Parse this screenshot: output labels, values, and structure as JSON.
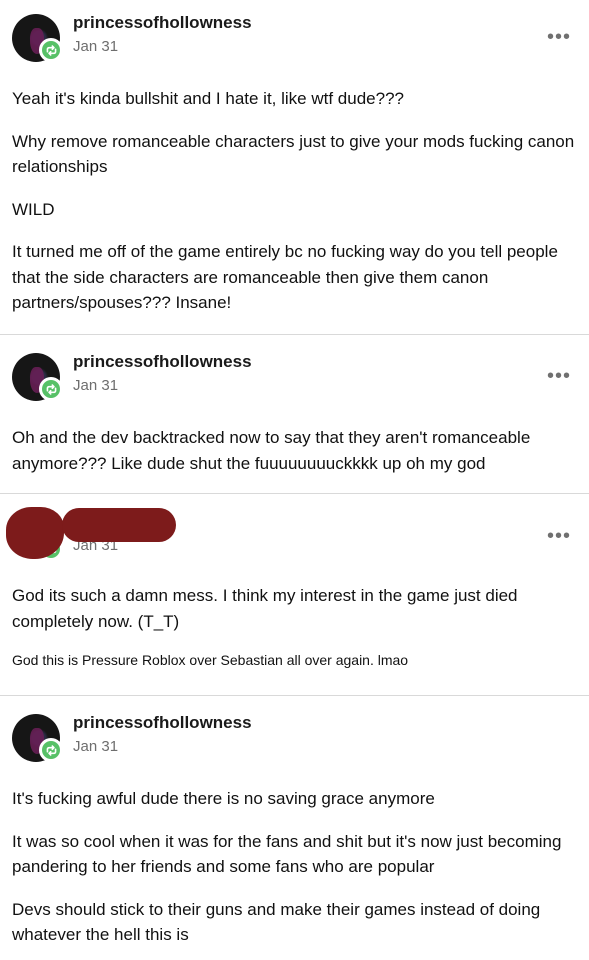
{
  "posts": [
    {
      "username": "princessofhollowness",
      "date": "Jan 31",
      "paragraphs": [
        "Yeah it's kinda bullshit and I hate it, like wtf dude???",
        "Why remove romanceable characters just to give your mods fucking canon relationships",
        "WILD",
        "It turned me off of the game entirely bc no fucking way do you tell people that the side characters are romanceable then give them canon partners/spouses??? Insane!"
      ]
    },
    {
      "username": "princessofhollowness",
      "date": "Jan 31",
      "paragraphs": [
        "Oh and the dev backtracked now to say that they aren't romanceable anymore??? Like dude shut the fuuuuuuuuckkkk up oh my god"
      ]
    },
    {
      "username": "",
      "date": "Jan 31",
      "paragraphs": [
        "God its such a damn mess. I think my interest in the game just died completely now. (T_T)"
      ],
      "small_text": "God this is Pressure Roblox over Sebastian all over again. lmao"
    },
    {
      "username": "princessofhollowness",
      "date": "Jan 31",
      "paragraphs": [
        "It's fucking awful dude there is no saving grace anymore",
        "It was so cool when it was for the fans and shit but it's now just becoming pandering to her friends and some fans who are popular",
        "Devs should stick to their guns and make their games instead of doing whatever the hell this is"
      ]
    }
  ],
  "more_menu_label": "•••",
  "icons": {
    "avatar": "avatar-icon",
    "reblog": "reblog-icon",
    "more": "more-options-icon"
  },
  "colors": {
    "reblog_badge": "#57c167",
    "redaction": "#7d1b1b",
    "divider": "#d9d9d9"
  }
}
